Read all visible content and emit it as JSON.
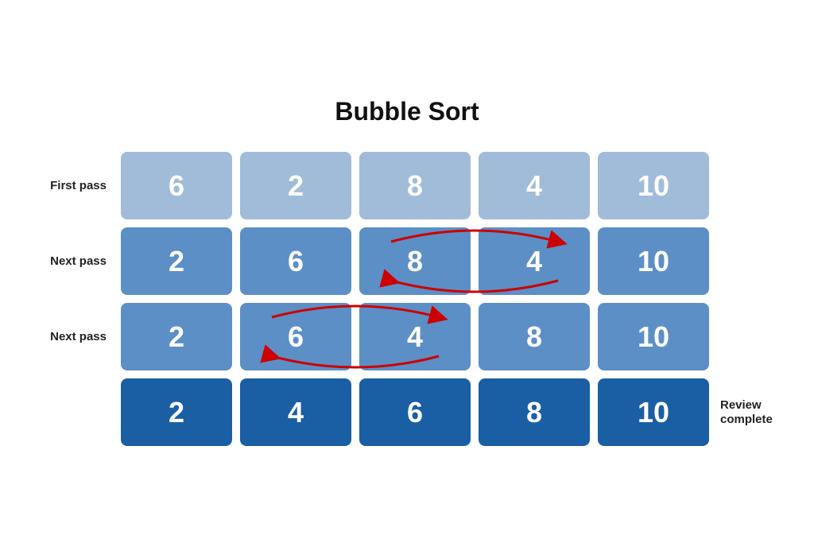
{
  "title": "Bubble Sort",
  "rows": [
    {
      "label": "First pass",
      "cells": [
        6,
        2,
        8,
        4,
        10
      ],
      "colorClass": "cell-light",
      "suffix": "",
      "swap": null
    },
    {
      "label": "Next pass",
      "cells": [
        2,
        6,
        8,
        4,
        10
      ],
      "colorClass": "cell-mid",
      "suffix": "",
      "swap": "row2"
    },
    {
      "label": "Next pass",
      "cells": [
        2,
        6,
        4,
        8,
        10
      ],
      "colorClass": "cell-mid",
      "suffix": "",
      "swap": "row3"
    },
    {
      "label": "",
      "cells": [
        2,
        4,
        6,
        8,
        10
      ],
      "colorClass": "cell-dark",
      "suffix": "Review complete",
      "swap": null
    }
  ]
}
